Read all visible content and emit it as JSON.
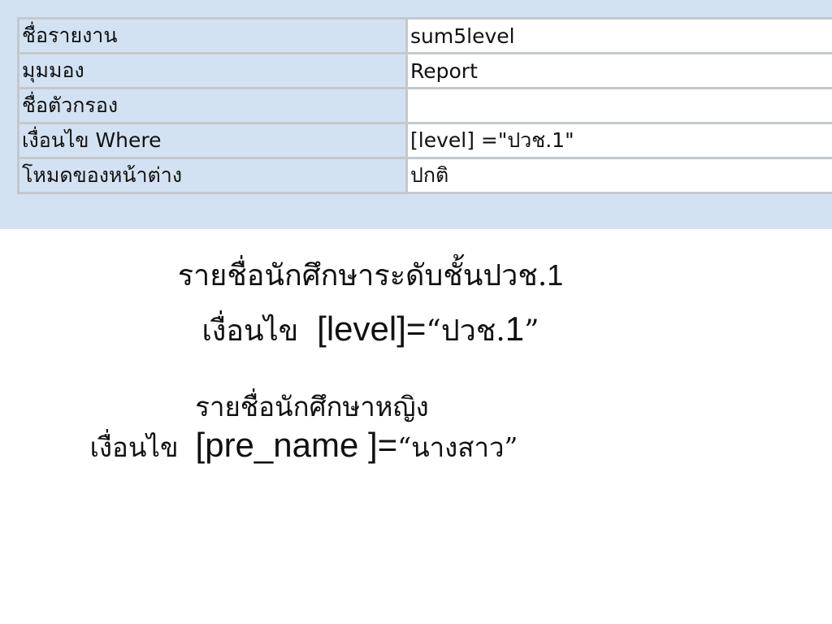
{
  "properties": [
    {
      "label": "ชื่อรายงาน",
      "value": "sum5level"
    },
    {
      "label": "มุมมอง",
      "value": "Report"
    },
    {
      "label": "ชื่อตัวกรอง",
      "value": ""
    },
    {
      "label": "เงื่อนไข Where",
      "value": "[level] =\"ปวช.1\""
    },
    {
      "label": "โหมดของหน้าต่าง",
      "value": "ปกติ"
    }
  ],
  "slide": {
    "line1": {
      "thai": "รายชื่อนักศึกษาระดับชั้นปวช.",
      "num": "1"
    },
    "line2": {
      "prefix": "เงื่อนไข",
      "code": "[level]=",
      "open_quote": "“",
      "thai_value": "ปวช.",
      "num": "1",
      "close_quote": "”"
    },
    "line3": {
      "thai": "รายชื่อนักศึกษาหญิง"
    },
    "line4": {
      "prefix": "เงื่อนไข",
      "code": "[pre_name ]=",
      "open_quote": "“",
      "thai_value": "นางสาว",
      "close_quote": "”"
    }
  },
  "colors": {
    "panel_background": "#d3e2f2",
    "grid_border": "#c3c8cd",
    "value_background": "#ffffff"
  }
}
